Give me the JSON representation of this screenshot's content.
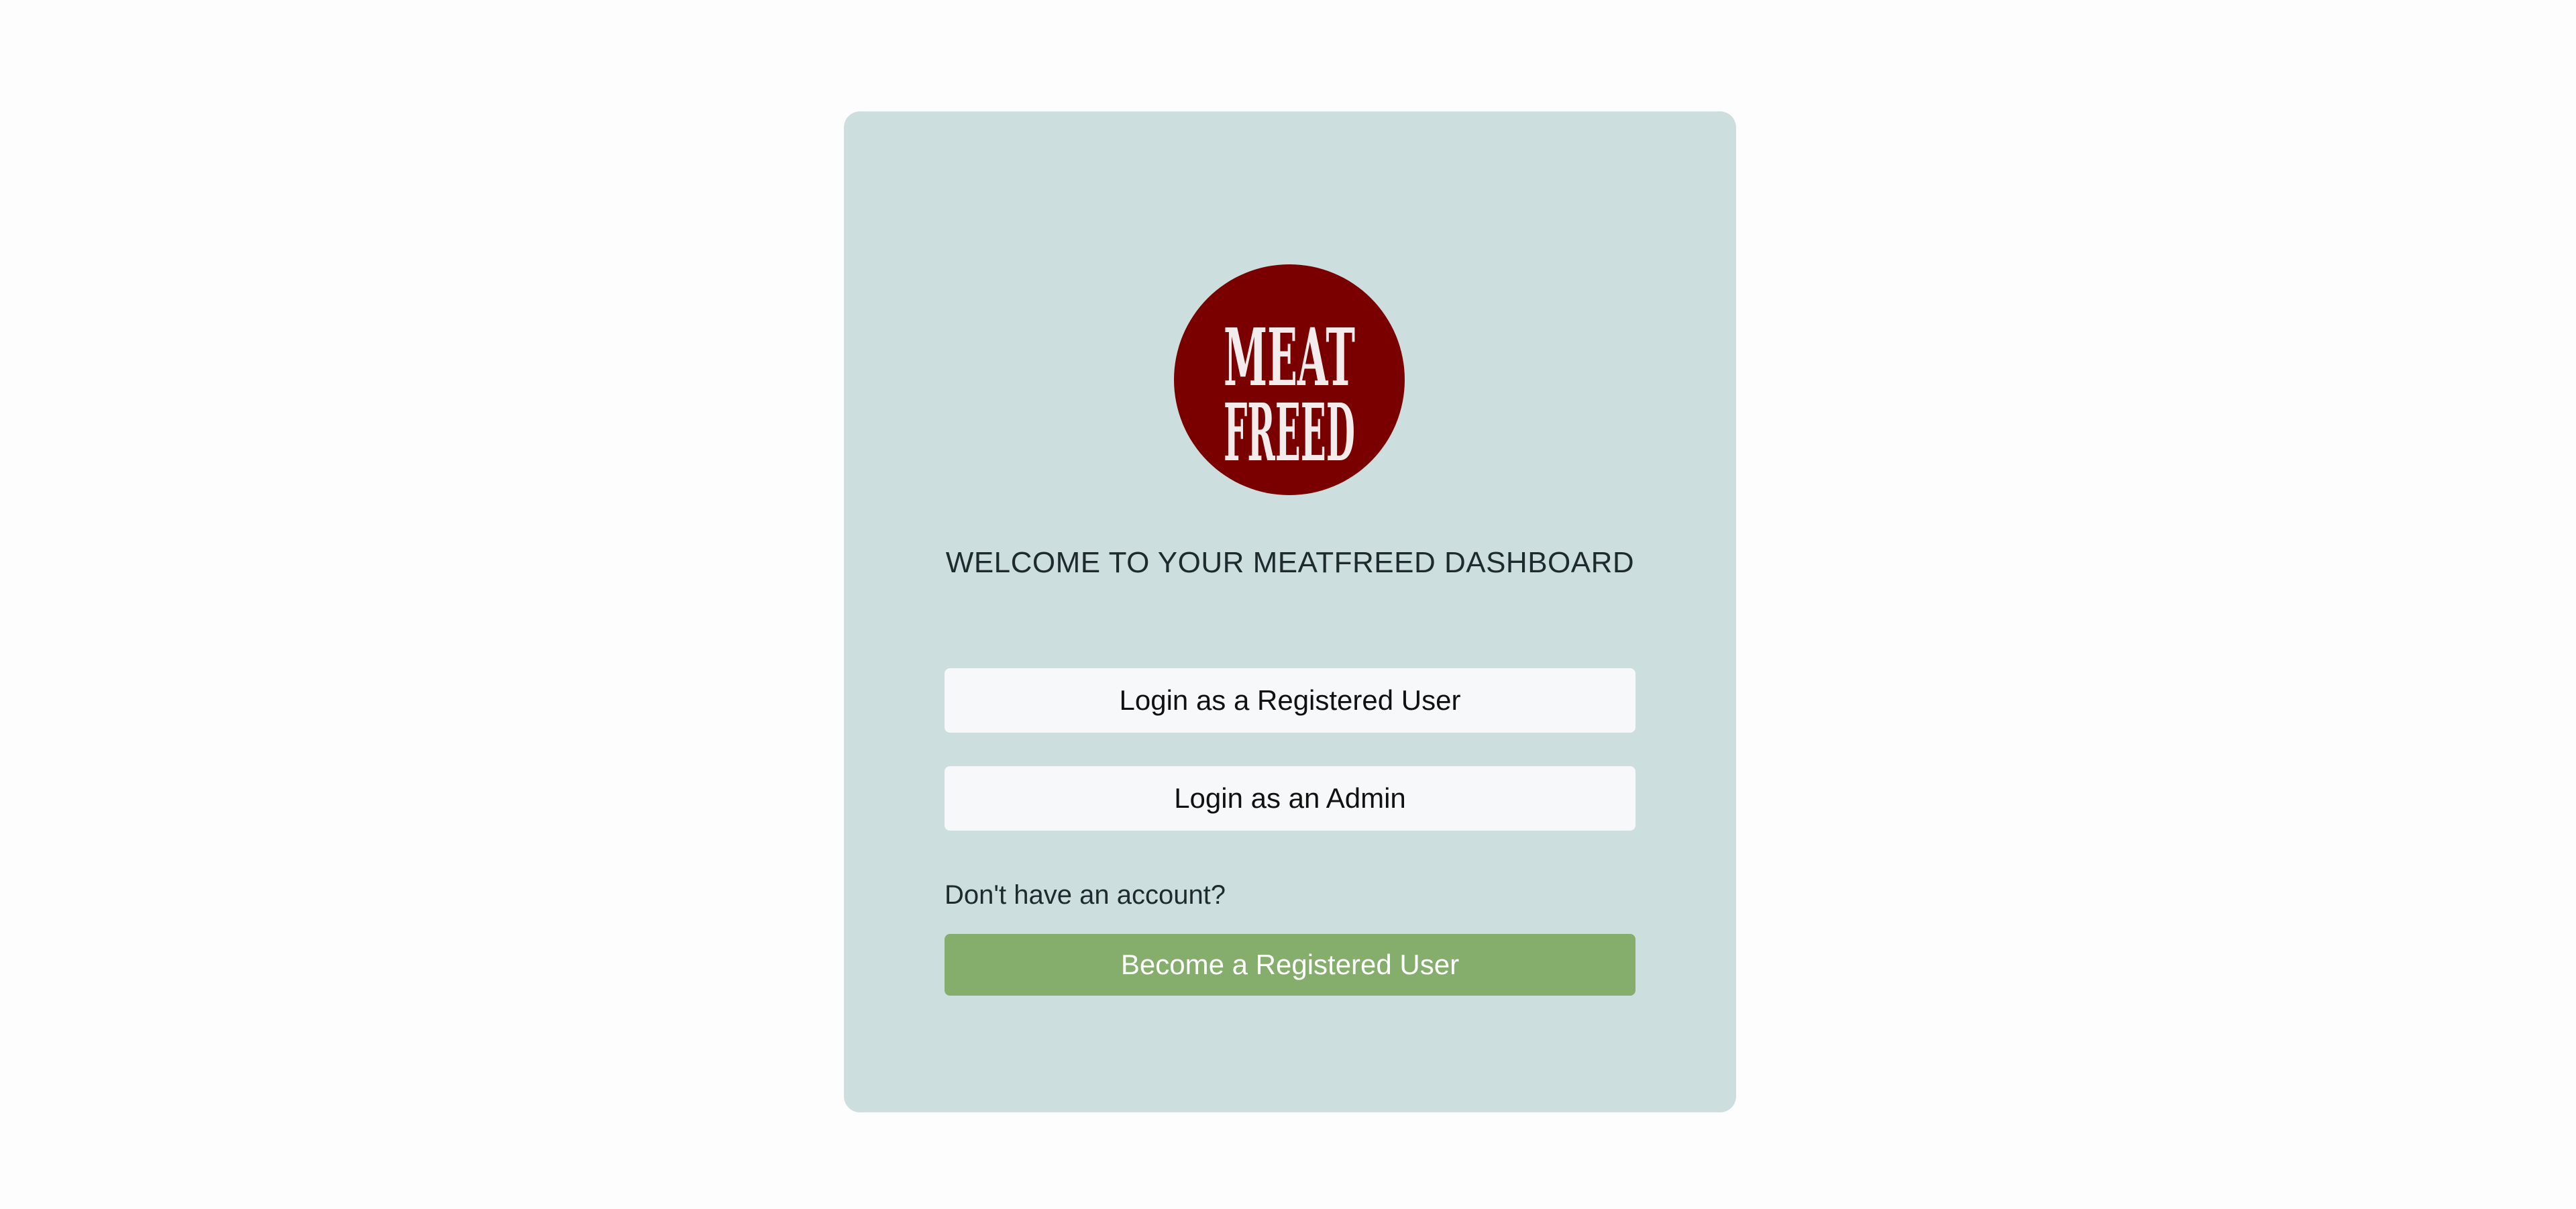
{
  "logo": {
    "line1": "MEAT",
    "line2": "FREED",
    "bg_color": "#7a0000",
    "text_color": "#f4ecec"
  },
  "title": "WELCOME TO YOUR MEATFREED DASHBOARD",
  "buttons": {
    "login_user": "Login as a Registered User",
    "login_admin": "Login as an Admin",
    "register": "Become a Registered User"
  },
  "signup_prompt": "Don't have an account?",
  "colors": {
    "card_bg": "#ccdede",
    "register_button": "#85ae6c",
    "login_button": "#f6f8f9"
  }
}
